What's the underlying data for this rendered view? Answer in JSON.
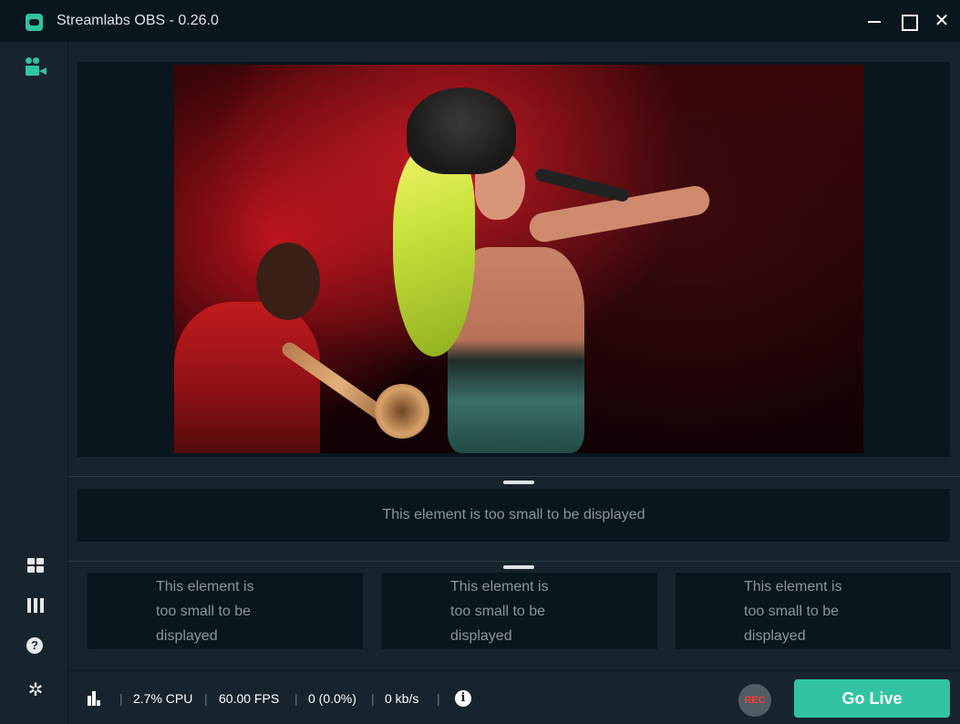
{
  "window": {
    "title": "Streamlabs OBS - 0.26.0",
    "close_glyph": "✕"
  },
  "sidebar": {
    "items": [
      {
        "name": "studio-icon"
      },
      {
        "name": "layout-icon"
      },
      {
        "name": "mixer-icon"
      },
      {
        "name": "help-icon",
        "glyph": "?"
      },
      {
        "name": "settings-icon",
        "glyph": "✲"
      }
    ]
  },
  "panels": {
    "wide_message": "This element is too small to be displayed",
    "columns": [
      {
        "line1": "This element is",
        "line2": "too small to be",
        "line3": "displayed"
      },
      {
        "line1": "This element is",
        "line2": "too small to be",
        "line3": "displayed"
      },
      {
        "line1": "This element is",
        "line2": "too small to be",
        "line3": "displayed"
      }
    ]
  },
  "footer": {
    "separator": "|",
    "cpu": "2.7% CPU",
    "fps": "60.00 FPS",
    "dropped": "0 (0.0%)",
    "bitrate": "0 kb/s",
    "info_glyph": "i",
    "rec_label": "REC",
    "go_live_label": "Go Live"
  },
  "colors": {
    "accent": "#31c3a2",
    "background": "#17242d",
    "panel": "#09161d",
    "rec": "#fc3a3a"
  }
}
